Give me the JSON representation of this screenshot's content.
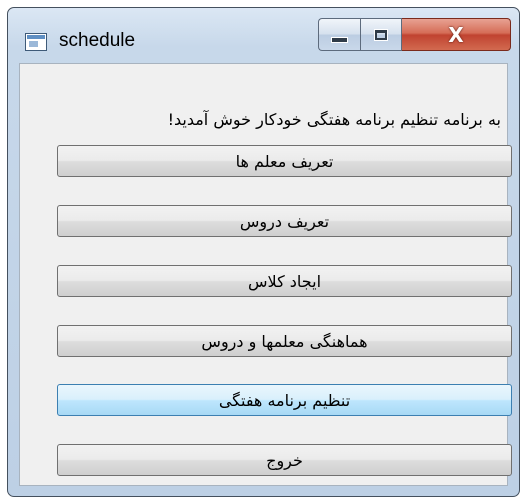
{
  "window": {
    "title": "schedule",
    "icon": "application-window-icon",
    "controls": {
      "minimize": "minimize-icon",
      "maximize": "maximize-icon",
      "close_label": "X"
    }
  },
  "main": {
    "welcome_text": "به برنامه تنظیم برنامه هفتگی خودکار خوش آمدید!",
    "buttons": [
      {
        "label": "تعریف معلم ها"
      },
      {
        "label": "تعریف دروس"
      },
      {
        "label": "ایجاد کلاس"
      },
      {
        "label": "هماهنگی معلمها و دروس"
      },
      {
        "label": "تنظیم برنامه هفتگی",
        "state": "hover"
      },
      {
        "label": "خروج"
      }
    ]
  },
  "colors": {
    "frame": "#c7d8ea",
    "close_button": "#c04330",
    "client_bg": "#f0f0f0",
    "hover_button": "#bee6fd"
  }
}
